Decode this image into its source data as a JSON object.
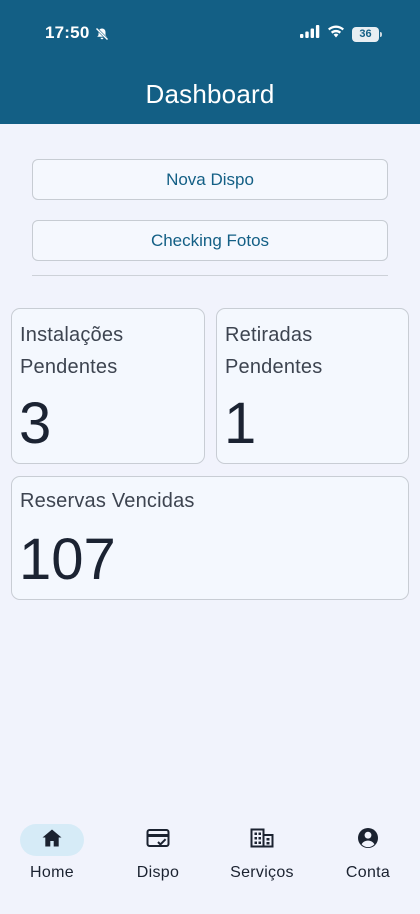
{
  "status_bar": {
    "time": "17:50",
    "battery": "36",
    "icons": [
      "bell-off-icon",
      "signal-icon",
      "wifi-icon",
      "battery-icon"
    ]
  },
  "header": {
    "title": "Dashboard",
    "background": "#135f85"
  },
  "actions": {
    "nova_dispo": "Nova Dispo",
    "checking_fotos": "Checking Fotos"
  },
  "stats": {
    "instalacoes": {
      "label": "Instalações Pendentes",
      "value": "3"
    },
    "retiradas": {
      "label": "Retiradas Pendentes",
      "value": "1"
    },
    "reservas": {
      "label": "Reservas Vencidas",
      "value": "107"
    }
  },
  "bottom_nav": {
    "items": [
      {
        "label": "Home",
        "icon": "home-icon",
        "active": true
      },
      {
        "label": "Dispo",
        "icon": "card-check-icon",
        "active": false
      },
      {
        "label": "Serviços",
        "icon": "building-icon",
        "active": false
      },
      {
        "label": "Conta",
        "icon": "account-icon",
        "active": false
      }
    ]
  },
  "colors": {
    "accent": "#135f85",
    "background": "#f1f3fc",
    "active_nav_pill": "#d6ebf7"
  }
}
